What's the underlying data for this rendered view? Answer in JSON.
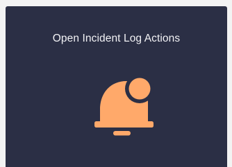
{
  "card": {
    "title": "Open Incident Log Actions",
    "icon": "bell-notification-icon",
    "background_color": "#2b2f45",
    "accent_color": "#ffa96a"
  }
}
